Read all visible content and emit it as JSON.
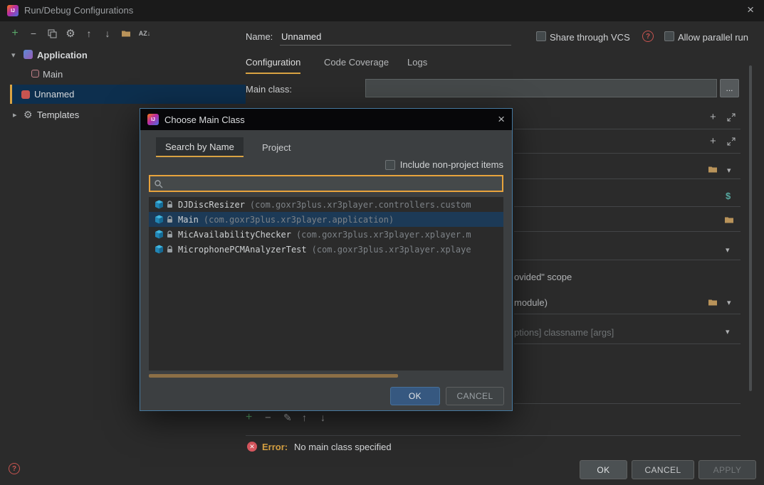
{
  "titlebar": {
    "title": "Run/Debug Configurations"
  },
  "icons": {
    "logo": "IJ",
    "close": "×",
    "add": "+",
    "remove": "−",
    "gear": "⚙",
    "up": "↑",
    "down": "↓",
    "sort": "AZ↓",
    "pencil": "✎",
    "dropdown": "▾",
    "dollar": "$",
    "help": "?",
    "chevron_down": "▾",
    "chevron_right": "▸",
    "error_mark": "✕"
  },
  "sidebar": {
    "tree": [
      {
        "label": "Application"
      },
      {
        "label": "Main"
      },
      {
        "label": "Unnamed"
      },
      {
        "label": "Templates"
      }
    ]
  },
  "header": {
    "name_label": "Name:",
    "name_value": "Unnamed",
    "share_vcs": "Share through VCS",
    "allow_parallel": "Allow parallel run"
  },
  "tabs": [
    {
      "label": "Configuration"
    },
    {
      "label": "Code Coverage"
    },
    {
      "label": "Logs"
    }
  ],
  "form": {
    "main_class_label": "Main class:",
    "main_class_value": "",
    "browse": "...",
    "scope_fragment": "ovided\" scope",
    "module_fragment": "module)",
    "args_fragment": "ptions] classname [args]"
  },
  "modal": {
    "title": "Choose Main Class",
    "tabs": [
      {
        "label": "Search by Name"
      },
      {
        "label": "Project"
      }
    ],
    "include_non_project": "Include non-project items",
    "search_value": "",
    "items": [
      {
        "name": "DJDiscResizer",
        "package": "(com.goxr3plus.xr3player.controllers.custom"
      },
      {
        "name": "Main",
        "package": "(com.goxr3plus.xr3player.application)"
      },
      {
        "name": "MicAvailabilityChecker",
        "package": "(com.goxr3plus.xr3player.xplayer.m"
      },
      {
        "name": "MicrophonePCMAnalyzerTest",
        "package": "(com.goxr3plus.xr3player.xplaye"
      }
    ],
    "ok": "OK",
    "cancel": "CANCEL"
  },
  "error": {
    "label": "Error:",
    "message": "No main class specified"
  },
  "footer": {
    "ok": "OK",
    "cancel": "CANCEL",
    "apply": "APPLY"
  },
  "colors": {
    "accent": "#d9a343",
    "error": "#db5860",
    "primary_button": "#365880",
    "selection": "#1c3a57",
    "tree_selection": "#0d2f4e"
  }
}
